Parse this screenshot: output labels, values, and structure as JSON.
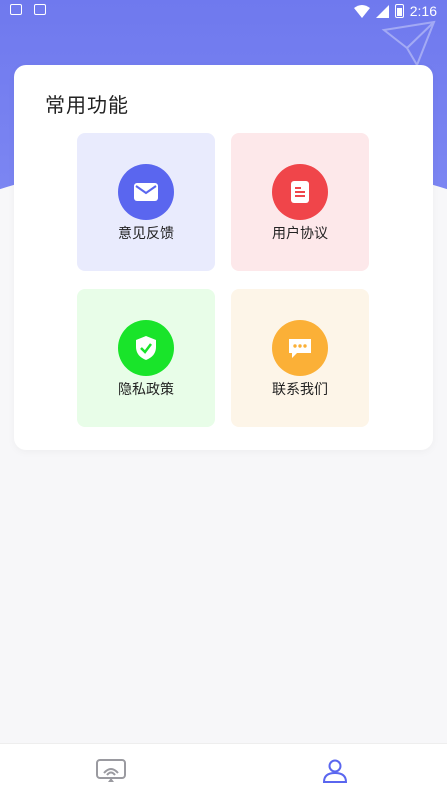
{
  "status_bar": {
    "time": "2:16"
  },
  "section": {
    "title": "常用功能"
  },
  "features": [
    {
      "label": "意见反馈",
      "icon": "mail-icon",
      "color": "#5a66ef"
    },
    {
      "label": "用户协议",
      "icon": "document-icon",
      "color": "#f0454a"
    },
    {
      "label": "隐私政策",
      "icon": "shield-check-icon",
      "color": "#19e42a"
    },
    {
      "label": "联系我们",
      "icon": "chat-bubble-icon",
      "color": "#fbb037"
    }
  ],
  "bottom_nav": [
    {
      "icon": "cast-screen-icon",
      "active": false
    },
    {
      "icon": "user-profile-icon",
      "active": true,
      "color": "#5a66ef"
    }
  ]
}
